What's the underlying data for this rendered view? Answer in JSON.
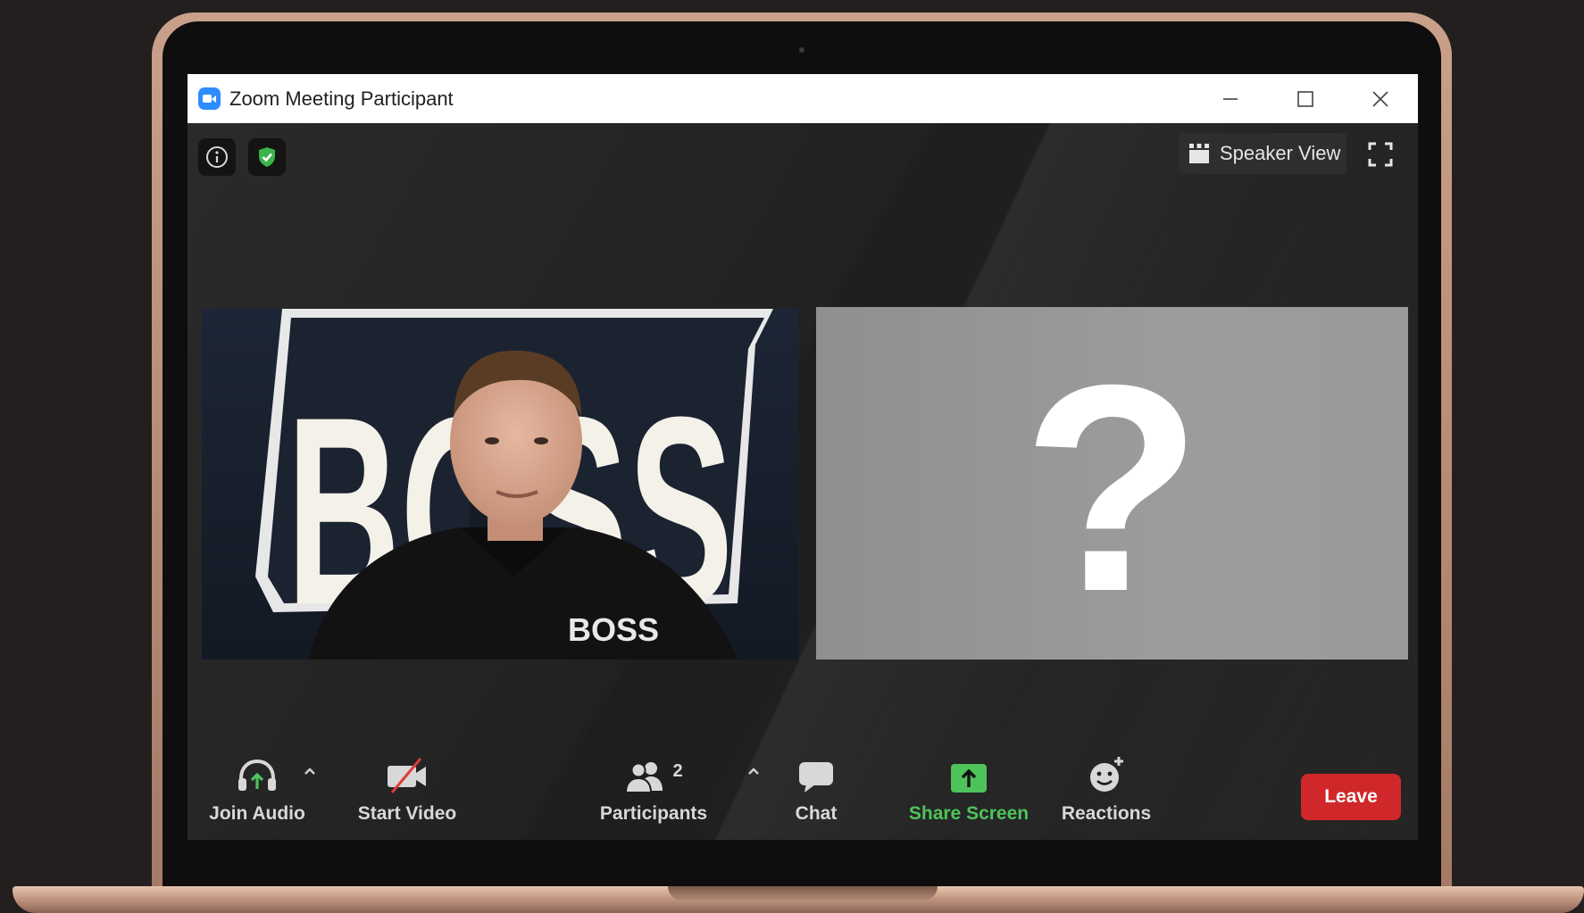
{
  "window": {
    "title": "Zoom Meeting Participant"
  },
  "window_controls": {
    "minimize": "—",
    "maximize": "☐",
    "close": "✕"
  },
  "top_bar": {
    "view_label": "Speaker View"
  },
  "tiles": {
    "participant_photo_text": "BOSS",
    "placeholder": "?"
  },
  "toolbar": {
    "join_audio": "Join Audio",
    "start_video": "Start Video",
    "participants": "Participants",
    "participant_count": "2",
    "chat": "Chat",
    "share_screen": "Share Screen",
    "reactions": "Reactions",
    "leave": "Leave"
  },
  "icons": [
    "zoom-logo-icon",
    "info-icon",
    "shield-check-icon",
    "gallery-grid-icon",
    "fullscreen-icon",
    "headphones-icon",
    "video-off-icon",
    "participants-icon",
    "chat-icon",
    "share-screen-icon",
    "reactions-icon",
    "caret-up-icon"
  ],
  "colors": {
    "share_green": "#4ec35a",
    "leave_red": "#d0282a",
    "zoom_blue": "#2d8cff",
    "shield_green": "#3bb54a"
  }
}
